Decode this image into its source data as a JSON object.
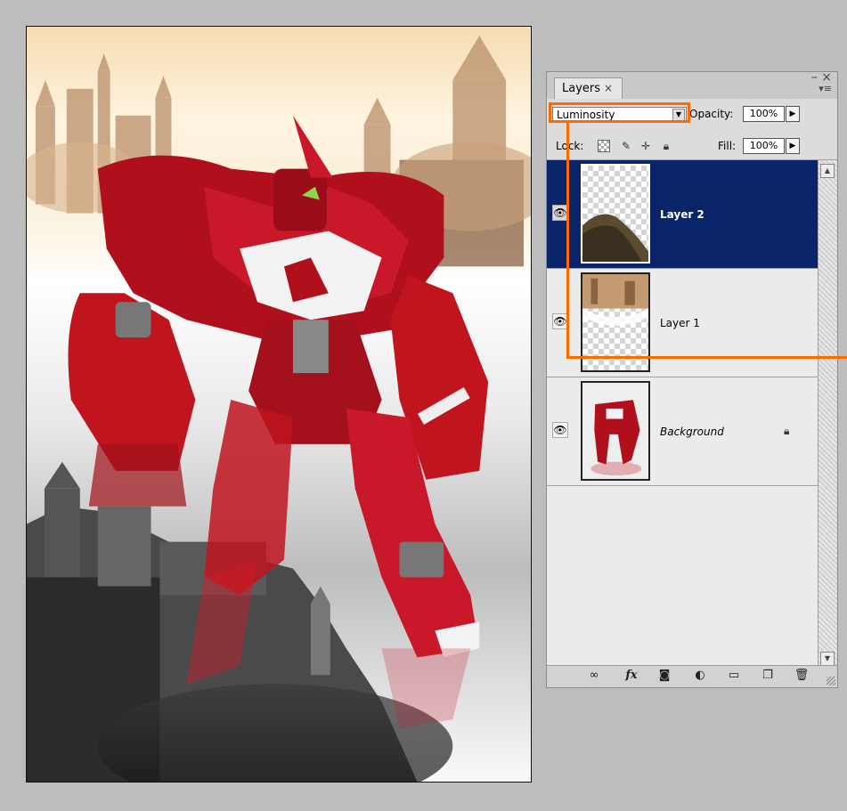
{
  "layers_panel": {
    "tab_label": "Layers",
    "close_glyph": "×",
    "minimize_glyph": "– ×",
    "menu_glyph": "▾≡",
    "blend_mode": "Luminosity",
    "opacity_label": "Opacity:",
    "opacity_value": "100%",
    "lock_label": "Lock:",
    "fill_label": "Fill:",
    "fill_value": "100%",
    "layers": [
      {
        "name": "Layer 2",
        "selected": true,
        "visible": true
      },
      {
        "name": "Layer 1",
        "selected": false,
        "visible": true
      },
      {
        "name": "Background",
        "selected": false,
        "visible": true,
        "locked": true
      }
    ],
    "footer_icons": [
      "link-layers-icon",
      "fx-icon",
      "layer-mask-icon",
      "adjustment-layer-icon",
      "new-group-icon",
      "new-layer-icon",
      "trash-icon"
    ],
    "fx_label": "fx"
  },
  "colors": {
    "selection": "#0a246a",
    "annotation": "#ff6a00",
    "panel_bg": "#d6d6d6"
  }
}
